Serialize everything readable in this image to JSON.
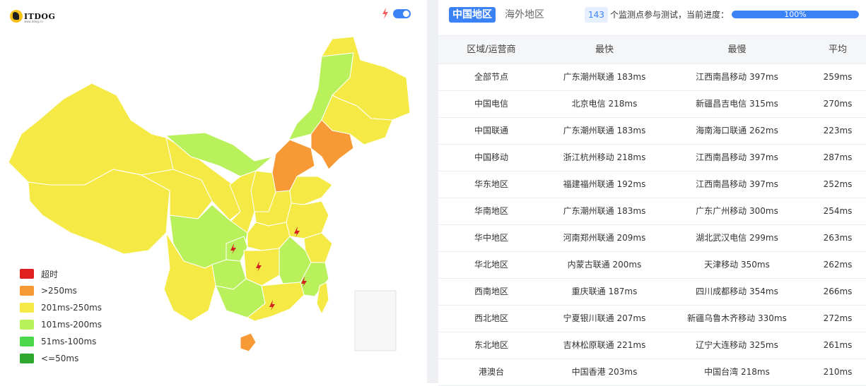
{
  "colors": {
    "accent": "#3b82f6",
    "timeout": "#e02020",
    "over250": "#f79a36",
    "r201_250": "#f5e946",
    "r101_200": "#b9f15c",
    "r51_100": "#4cd84a",
    "le50": "#2ea82e"
  },
  "logo": {
    "text": "ITDOG",
    "sub": "www.itdog.cn"
  },
  "legend": [
    {
      "label": "超时",
      "color": "#e02020"
    },
    {
      "label": ">250ms",
      "color": "#f79a36"
    },
    {
      "label": "201ms-250ms",
      "color": "#f5e946"
    },
    {
      "label": "101ms-200ms",
      "color": "#b9f15c"
    },
    {
      "label": "51ms-100ms",
      "color": "#4cd84a"
    },
    {
      "label": "<=50ms",
      "color": "#2ea82e"
    }
  ],
  "tabs": {
    "domestic": "中国地区",
    "overseas": "海外地区"
  },
  "monitor": {
    "count": "143",
    "text": "个监测点参与测试，当前进度：",
    "progress": 1.0,
    "progress_label": "100%"
  },
  "table": {
    "headers": [
      "区域/运营商",
      "最快",
      "最慢",
      "平均"
    ],
    "rows": [
      [
        "全部节点",
        "广东潮州联通 183ms",
        "江西南昌移动 397ms",
        "259ms"
      ],
      [
        "中国电信",
        "北京电信 218ms",
        "新疆昌吉电信 315ms",
        "270ms"
      ],
      [
        "中国联通",
        "广东潮州联通 183ms",
        "海南海口联通 262ms",
        "223ms"
      ],
      [
        "中国移动",
        "浙江杭州移动 218ms",
        "江西南昌移动 397ms",
        "287ms"
      ],
      [
        "华东地区",
        "福建福州联通 192ms",
        "江西南昌移动 397ms",
        "252ms"
      ],
      [
        "华南地区",
        "广东潮州联通 183ms",
        "广东广州移动 300ms",
        "254ms"
      ],
      [
        "华中地区",
        "河南郑州联通 209ms",
        "湖北武汉电信 299ms",
        "263ms"
      ],
      [
        "华北地区",
        "内蒙古联通 200ms",
        "天津移动 350ms",
        "262ms"
      ],
      [
        "西南地区",
        "重庆联通 187ms",
        "四川成都移动 354ms",
        "266ms"
      ],
      [
        "西北地区",
        "宁夏银川联通 207ms",
        "新疆乌鲁木齐移动 330ms",
        "272ms"
      ],
      [
        "东北地区",
        "吉林松原联通 221ms",
        "辽宁大连移动 325ms",
        "261ms"
      ],
      [
        "港澳台",
        "中国香港 203ms",
        "中国台湾 218ms",
        "210ms"
      ]
    ]
  }
}
